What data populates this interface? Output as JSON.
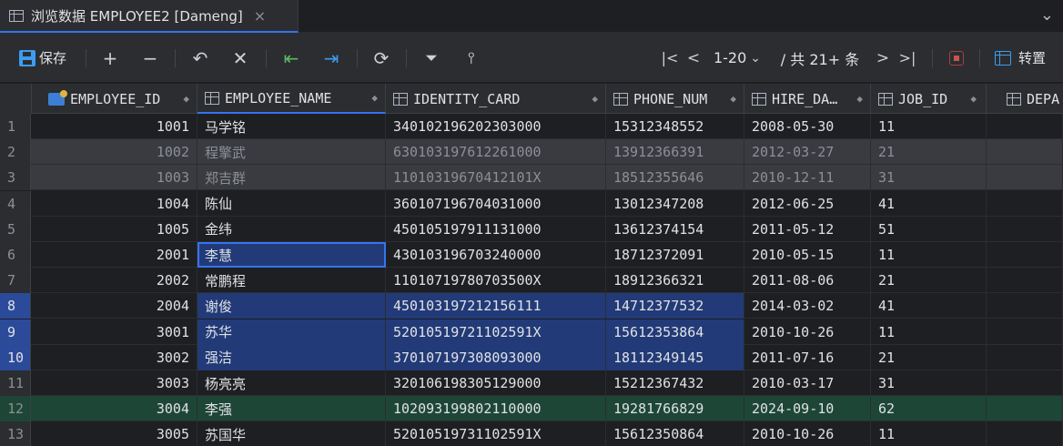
{
  "tab": {
    "title": "浏览数据 EMPLOYEE2 [Dameng]",
    "close": "×",
    "overflow": "⌄"
  },
  "toolbar": {
    "save_label": "保存",
    "pager_range": "1-20",
    "pager_total": "/ 共 21+ 条",
    "transpose_label": "转置"
  },
  "columns": [
    {
      "name": "EMPLOYEE_ID",
      "icon": "primary-key-icon"
    },
    {
      "name": "EMPLOYEE_NAME",
      "icon": "column-icon"
    },
    {
      "name": "IDENTITY_CARD",
      "icon": "column-icon"
    },
    {
      "name": "PHONE_NUM",
      "icon": "column-icon"
    },
    {
      "name": "HIRE_DA…",
      "icon": "column-icon"
    },
    {
      "name": "JOB_ID",
      "icon": "column-icon"
    },
    {
      "name": "DEPA",
      "icon": "column-icon"
    }
  ],
  "rows": [
    {
      "n": "1",
      "id": "1001",
      "name": "马学铭",
      "card": "340102196202303000",
      "phone": "15312348552",
      "hire": "2008-05-30",
      "job": "11",
      "state": "normal"
    },
    {
      "n": "2",
      "id": "1002",
      "name": "程擎武",
      "card": "630103197612261000",
      "phone": "13912366391",
      "hire": "2012-03-27",
      "job": "21",
      "state": "dim"
    },
    {
      "n": "3",
      "id": "1003",
      "name": "郑吉群",
      "card": "11010319670412101X",
      "phone": "18512355646",
      "hire": "2010-12-11",
      "job": "31",
      "state": "dim"
    },
    {
      "n": "4",
      "id": "1004",
      "name": "陈仙",
      "card": "360107196704031000",
      "phone": "13012347208",
      "hire": "2012-06-25",
      "job": "41",
      "state": "normal"
    },
    {
      "n": "5",
      "id": "1005",
      "name": "金纬",
      "card": "450105197911131000",
      "phone": "13612374154",
      "hire": "2011-05-12",
      "job": "51",
      "state": "normal"
    },
    {
      "n": "6",
      "id": "2001",
      "name": "李慧",
      "card": "430103196703240000",
      "phone": "18712372091",
      "hire": "2010-05-15",
      "job": "11",
      "state": "focus"
    },
    {
      "n": "7",
      "id": "2002",
      "name": "常鹏程",
      "card": "11010719780703500X",
      "phone": "18912366321",
      "hire": "2011-08-06",
      "job": "21",
      "state": "normal"
    },
    {
      "n": "8",
      "id": "2004",
      "name": "谢俊",
      "card": "450103197212156111",
      "phone": "14712377532",
      "hire": "2014-03-02",
      "job": "41",
      "state": "sel"
    },
    {
      "n": "9",
      "id": "3001",
      "name": "苏华",
      "card": "52010519721102591X",
      "phone": "15612353864",
      "hire": "2010-10-26",
      "job": "11",
      "state": "sel"
    },
    {
      "n": "10",
      "id": "3002",
      "name": "强洁",
      "card": "370107197308093000",
      "phone": "18112349145",
      "hire": "2011-07-16",
      "job": "21",
      "state": "sel"
    },
    {
      "n": "11",
      "id": "3003",
      "name": "杨亮亮",
      "card": "320106198305129000",
      "phone": "15212367432",
      "hire": "2010-03-17",
      "job": "31",
      "state": "normal"
    },
    {
      "n": "12",
      "id": "3004",
      "name": "李强",
      "card": "102093199802110000",
      "phone": "19281766829",
      "hire": "2024-09-10",
      "job": "62",
      "state": "green"
    },
    {
      "n": "13",
      "id": "3005",
      "name": "苏国华",
      "card": "52010519731102591X",
      "phone": "15612350864",
      "hire": "2010-10-26",
      "job": "11",
      "state": "normal"
    }
  ]
}
